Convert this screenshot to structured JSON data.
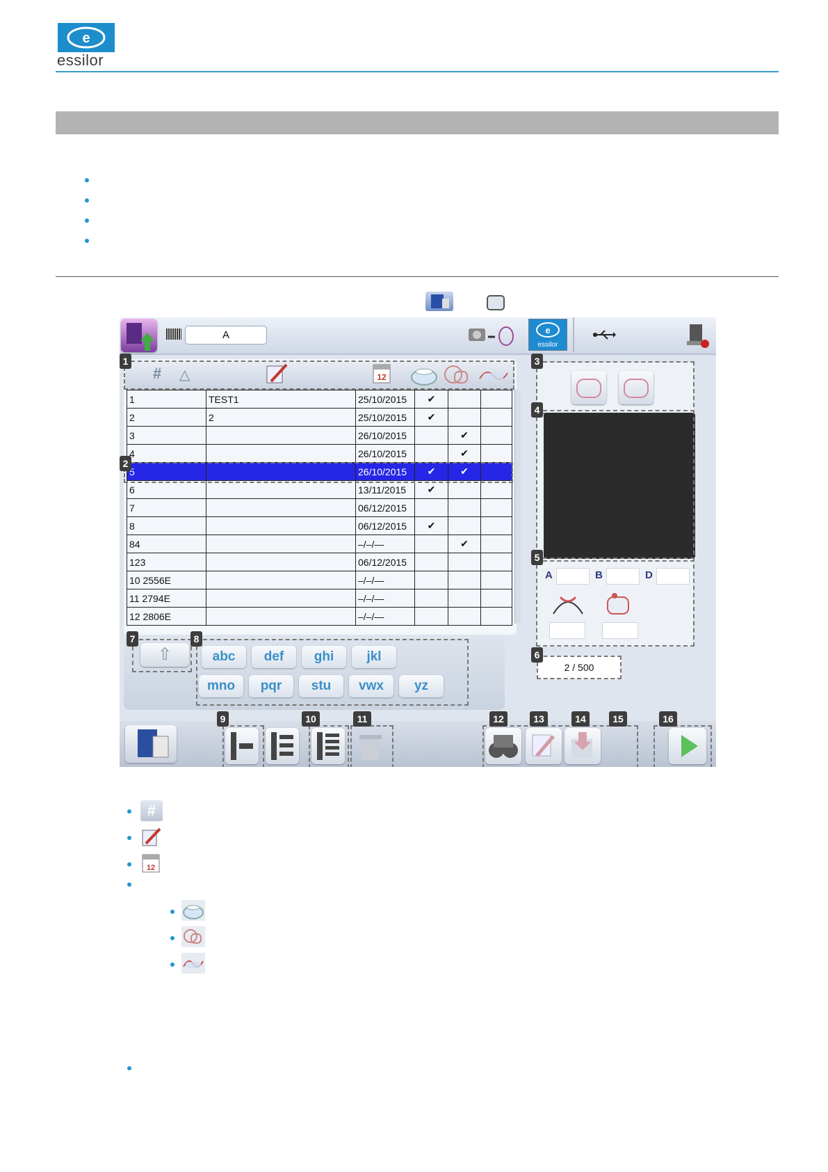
{
  "header": {
    "logo_text": "essilor",
    "accent_color": "#1d8dcc"
  },
  "section": {
    "bullet_count": 4
  },
  "screen": {
    "search_value": "A",
    "logo_text": "essilor",
    "columns": [
      {
        "name": "hash-column-icon",
        "glyph": "#"
      },
      {
        "name": "sort-ascending-icon",
        "glyph": "△"
      },
      {
        "name": "name-column-icon",
        "glyph": "✎"
      },
      {
        "name": "date-column-icon",
        "glyph": "12"
      },
      {
        "name": "lens-column-icon",
        "glyph": "◠"
      },
      {
        "name": "shape-column-icon",
        "glyph": "○"
      },
      {
        "name": "frame-column-icon",
        "glyph": "∿"
      }
    ],
    "rows": [
      {
        "num": "1",
        "name": "TEST1",
        "date": "25/10/2015",
        "c1": "✔",
        "c2": "",
        "c3": ""
      },
      {
        "num": "2",
        "name": "2",
        "date": "25/10/2015",
        "c1": "✔",
        "c2": "",
        "c3": ""
      },
      {
        "num": "3",
        "name": "",
        "date": "26/10/2015",
        "c1": "",
        "c2": "✔",
        "c3": ""
      },
      {
        "num": "4",
        "name": "",
        "date": "26/10/2015",
        "c1": "",
        "c2": "✔",
        "c3": ""
      },
      {
        "num": "5",
        "name": "",
        "date": "26/10/2015",
        "c1": "✔",
        "c2": "✔",
        "c3": "",
        "selected": true
      },
      {
        "num": "6",
        "name": "",
        "date": "13/11/2015",
        "c1": "✔",
        "c2": "",
        "c3": ""
      },
      {
        "num": "7",
        "name": "",
        "date": "06/12/2015",
        "c1": "",
        "c2": "",
        "c3": ""
      },
      {
        "num": "8",
        "name": "",
        "date": "06/12/2015",
        "c1": "✔",
        "c2": "",
        "c3": ""
      },
      {
        "num": "84",
        "name": "",
        "date": "–/–/—",
        "c1": "",
        "c2": "✔",
        "c3": ""
      },
      {
        "num": "123",
        "name": "",
        "date": "06/12/2015",
        "c1": "",
        "c2": "",
        "c3": ""
      },
      {
        "num": "10  2556E",
        "name": "",
        "date": "–/–/—",
        "c1": "",
        "c2": "",
        "c3": ""
      },
      {
        "num": "11  2794E",
        "name": "",
        "date": "–/–/—",
        "c1": "",
        "c2": "",
        "c3": ""
      },
      {
        "num": "12  2806E",
        "name": "",
        "date": "–/–/—",
        "c1": "",
        "c2": "",
        "c3": ""
      }
    ],
    "keys_row1": [
      "abc",
      "def",
      "ghi",
      "jkl"
    ],
    "keys_row2": [
      "mno",
      "pqr",
      "stu",
      "vwx",
      "yz"
    ],
    "dim_labels": [
      "A",
      "B",
      "D"
    ],
    "counter": "2 / 500",
    "callouts": [
      "1",
      "2",
      "3",
      "4",
      "5",
      "6",
      "7",
      "8",
      "9",
      "10",
      "11",
      "12",
      "13",
      "14",
      "15",
      "16"
    ]
  },
  "legend": {
    "icons": [
      "hash-icon",
      "pen-icon",
      "calendar-icon"
    ],
    "sub_icons": [
      "lens-icon",
      "shape-icon",
      "frame-icon"
    ]
  }
}
